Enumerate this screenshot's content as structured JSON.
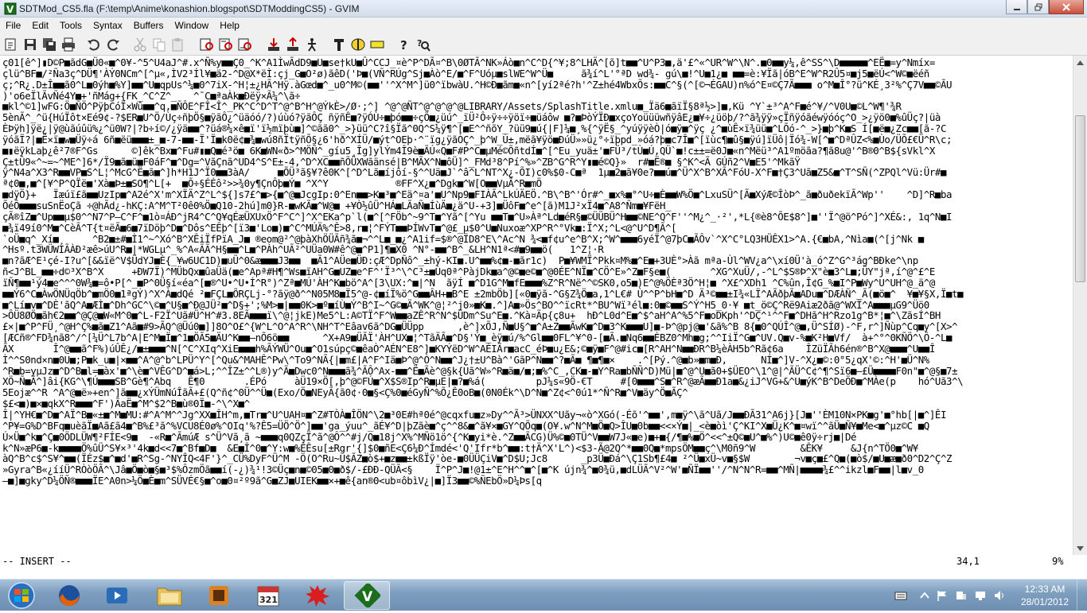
{
  "window": {
    "title": "SDTMod_CS5.fla (F:\\temp\\Anime\\konashion.blogspot\\SDTModdingCS5) - GVIM"
  },
  "menu": [
    "File",
    "Edit",
    "Tools",
    "Syntax",
    "Buffers",
    "Window",
    "Help"
  ],
  "toolbar_icons": [
    "open-icon",
    "save-icon",
    "save-all-icon",
    "print-icon",
    "undo-icon",
    "redo-icon",
    "cut-icon",
    "copy-icon",
    "paste-icon",
    "find-replace-icon",
    "find-next-icon",
    "find-prev-icon",
    "load-session-icon",
    "save-session-icon",
    "run-script-icon",
    "make-icon",
    "tag-jump-icon",
    "shell-icon",
    "help-icon",
    "find-help-icon"
  ],
  "editor": {
    "lines": [
      "ç01[ê^]▮D©P■ãdG■Ü0«■^0¥-^5^U4aJ^#.x^Ñ%y■■Ç0_^K^A1ÌwÃdD9■U■se†kU■Û^CCJ_¤è^P^DÃ¤^B\\0ØTÃ^NK»Áò■n^C^D{^¥;8^LHÄ^[õ]t■■^U^P3■,ä'£^«^UR^W^\\N^.■0■■y¼,ê^SS^\\D■■■■■^EË■=y^Nmíx=",
      "çlü^BF■/²Ña3ç^DÜ¶'ÀÝ0NCm^[^µ«,ÌV2³Íl¥■ä2-^D@X*ëÌ:çj_G■O²ø)ãêD('Þ■(VÑ^RÚg^Sj■Àò^E/■^F^Uóµ■slWE^W^Ü■     ã¾í^L'°ªD wd¾- gú\\■!^U■1¿■ ■■=è:¥Ïã|óB^E^W^R2Û5¤■j5■ëÚ<^W©■ëéñ",
      "ç;^R¿.D±Î■■ã0^L■0ýh■%Y]■■^U■qpUs^¼■0^7iX-^H¦±¿HÃ^Hÿ.àGœd■^_u0^M©(■■''^X^M^]ü0^ïbwàU.^H©Ð■ãm■«n^[yí2ªé?h'^Z±hé4WbxÕs:■■C^§(^[©¬ÉGAU)n%ó^E¤©Ç7Ã■■■ o^M■Î°?ü^KÉ¸3²%^Ç7V■■©ÃU",
      ")'o6eÏlÃvÑé4Y■+'ñMág+{FK_^C^Z^_   ^¯C■ªaÀk■Ðëÿ×Ã¼^\\ã÷",
      "■kl^©1]wFG:Ö■ÑÖ^PÿþCóÏ×Wû■■^q,■ÑÔE^FÎ<Î^_PK^C^D^T^@^B^H^@ÝkÈ>/Ø·;^] ^@^@ÑT^@^@^@^@LIBRARY/Assets/SplashTitle.xmlu■_Ïä6■ãïÏ§8ª½>]■,Kü ^Y`±³^A^F■é^¥/^V0U■©L^W¶'¾R",
      "5ènÃ^_^ü{HúÏôt×Eé9¢-?$ER■U^Ö/Ùç÷ñþÖ§■ÿãÔ¿^üäóó/?)úùó?ÿãÔÇ ñÿñÊ■?ÿÓÙ÷■þó■■÷çÕ■¿üú^_ïÜ²Ô÷ÿ÷÷ÿöï÷■üáôw ■?■ÞòÝÏÐ■xçoYoüüüwñÿâE¿■¥÷¿üöþ/?^ã¾ÿÿ»çÏñÿóãéwÿóóç^O_>¿ÿö0■%ûÜç?|üà",
      "ÈÞÿh]ÿë¿|ÿ@ùãúûü%¿^ü0W?|?b÷í©/¿ÿä■■^?üá®¼×ê■ï'ï½mïþù■]^©ãã0^_>}üü^C?î§Ïã^0Q^S¼ÿ¶^[■E^^ñõY_?üü9■ú{|F]¼■¸%{^ÿË§_^yúÿÿèÒ|ó■ÿ■^ÿç ¿^■ùÊ×ï¾üü■^LÕó-^_>}■þ^K■S Í[■ë■¿Zc■■[ã-?C",
      "ÿóãÏ?|■Ë×ï■w■Üÿ÷á 6ñ■ëü■■■±_■-7-■■-Ï'Ï■k0ë¢■¾■wú8ñÏtÿñÕ§¿6'hð^XÍÜ/■ýt^OEþ·^¨ïg¿ÿãÒÇ^_þ^W_Ù±,mëã¥ÿö■ÐúÜ»»ü¿°÷ïþpd_»óá?þ■c7Î■^[ïùc¶■û§■ÿú]ïÜô|Ïó¾-W[^■^DªÛZ<%■Ùo/ÜÕ£€Ü^R\\c;",
      "■▮ëÿkLaþ¿ê²7®F^Gs      ©]êk^Bx■^Fu#▮■Q■é³ö■ 6K■WN«ð>^MÖÑ^_gíu5¸Îg]ylÝm4Î9è■ÃÚ«Q■F#P^C■µMé©ÕñtdÍ■^[^Eu_yuä±'■FÜ³/tÙ■Ú,QÜ`■!c±±=ë0J■«n^Mëü³^A1ºmöãa?¶ã8u@'^B®0^B${sVkl^X",
      "Ç±tÛ9«^~=~^ME^]6*/Ï9■ã■ü■F0áF^■^Dg=^VãÇnã^UD4^S^E±-4,^D^XC■■ñÕÜXWãänsé|B^MÃX^N■ôÜ]^_FMd³8^Pí^%»^ZB^G^R^Y▮■é©Q}»  r#■Ë®■ §^K^<Ã GÚñ2^V■E5'^MkãŸ",
      "ÿ^N4a^X3^R■■VP■S^L¦^McG^Ë■ã■^]h*H1J^Ï0■■3àA/     ■ÕÜ³ã§¥?ê0K^[^D^Lã■íjôí-§^^Uä■J`^â^L^NT^X¿-ÕI)c0%$0-C■ª  1µ■2■ã¥0e?■■ú■^Ü^X^B^XÃ^FóU-X^F■†Ç3^Uã■Z5&■^T^SÑ(^ZPQl^Vü:Ür#■",
      "ª¢0■,■^[¥^P^QÏë■'Xà■Þ±■SO¶^L[+  ■Õ÷§ÉÉô²>>¾0y¶ÇnÔþ■Ý■ ^X^Y            ®FF^X¿■^Dgk■^W[O■■VµÃ^R■mÖ",
      "■dÿÖ}+   Ïæúï£ã■■UzIp■^A2é^X'm^XÏÄ^Z^L^${]s7£^■>{■^@■JcgIp:0^En■■>K■³■^Eä^¤a'■U^Np9■FIÀÃ^LkÚÄEÖ.^B\\^B^'Ór#^_■x%■°^U÷■È■■W%Ö■^LxuSÜ^[Ã■XýÆ©ÎòÞ^_ã■ðuðekïÃ^Wp''    ^D]^R■ba",
      "ÕéÔ■■■suSnËoÇã ÷@hÃd¿-hKÇ:A^M^T²0ê0%Ö■Q10-2hú]m0}R-■wKÃ■^W@■ +¥Ò½ûÜ^HÁ■LÃaÑ■ÍùÄ■¿ä^U-+3]■ÜôF■^e^[ã)M1J²xÏ4■^A8^Ñm■¥FëH_",
      "çÃ®îZ■^Up■■µ$0^^N7^P—C^F^■1ò¤ÁÐ^jR4^C^Q¥qÉæÜXUxÖ^F^C^]^X^EKa^p`l(■^[^FÖb^~9^T■^Yã^[^Yu ■■T■^U»Àª^Ld■éR§■©ÜÜBÜ^H■■©NE^Q^F''^M¿^_·²',*L{®è8^ÕE$8^]■''Ï^@ö^Pó^]^XÉ&:, 1q^N■I",
      "■¾ï49í0^M■^CèÃ^T{t¤ëÃ■6■7ïDöþ^D■^Dôs^EÊþ^[ï3■'Lo■)■^C^MÚÄ%^Ê>8,r■¦^FÝT■■ÞÍWvT■^@£_µ$0^U■Nuxoæ^XP^R^°Vk■:Ï^X;^L<@^U^D¶Ã^[",
      "`oÜ■q^_Xí■¸     ^B2■±#■Ì1^~^Xó^B^XÊiÏfPïA_J■ ®eom@²^@þàXhÖÜÃñ¾ã■¬^^L■_■¿^A1if=$®^@ÏD8^E\\^Ac^N ¾<■f¢u^e^B^X;^W^■■■6yéÏ^@7þC■ÃÔv`^X^C°LQ3HÜÊX1>^A.{€■bA,^Nìa■(^[j^Nk ■",
      "^Hsº.t3WÜWIÃÀÐ²æê>úU^R■|*WGLµ^_%^A«ÃÃ^H§■■^L■^PÀh^UÃ²^UÜa0W#ê^@■^P1]¶■X0 ^N°-■■^B^_&LH^N1ª<#■9■■ö(   1^Z¦·R",
      "■n?ãÆ^E¹çé-I?u^[&&ïë^V$ÜdYJ■È{_¥w6UC1D)■uÜ^0&æ■■■J3■■  ■Ã1^AÜe■ÜÐ:çÆ^DpÑô^_±hý-KI■.U^■■%¢■-■ãr1c)  P■¥WMÏ^Pkk¤M%■^E■+3UÈ°>Àã mªa-Ùl^WV¿a^\\xí0Ü'à_ó^Z^G^³ág^BÐke^\\np",
      "ñ<J^BL_■■÷d©³X^B^X     +ÐW7Ï)^MÜbQx■ûaÜä(■e^Apª#H¶^Ws■ïAH^G■UZ■e^F^'Ï³^\\^C³±■Ùq0ª^PàjDk■a^@©■e©■^@0ÉE^NÏ■^CÖ^E»^Z■F§e■(       ^XG^XuÜ/,-^L^$S®Þ^X\"è■3^L■;ÜY\"jª,í^@^£^E",
      "ïÑ¶■■¹ý4■e^^^0W¾■=ô•P[^_■P^0Ü§í«éa^[■®^U•^U•Í^R°)^Zª■MÚ'ÀH^K■bö^A^[3\\UX:^■|^N  ãÿÍ ■^D1G^M■fE■■■%Z^R^Në^^©SK0,o5■)E^@%ÖÈª3Ö^H¦■ ^X£^XDh1 ^C%ûn,Î¢G_%■I^P■Wy^U^UH^@_ä^@",
      "■■Ý6^C■ÀwÖNÜqÖb^■mÖ0■1ªgÝ)^X^À■dQé ²■FÇL■ÕRÇLj-°?ãÿ@ð^^N05M8■Ï5^@-¢■íÏ%ö^G■■ÂH+■B^E ±2mbÖb][«0■ÿã-^G§Z¾Ö■a,1^L€# Ù^^P^bH■^D Ä³©■■±I¾«LÏ^AÃðþÃ■ADu■^DÆÀÑ^_Ã(■ö■^  ¥■¥§X,Ï■t■",
      "■^Lí■v■^DÈ'ãQ^A■ÆÌ■^Dh^GC^\\©■^U§■^Ð@JÜ²■^D§+';%M>■|■■0K>■º■íÙ■Ý^B^I~^G©■Ä^WK^@¦²^j0»■K■.^]A■»Ös^BO^^ïcRt*^BU^Wï³él■:0■©■■S^Ý^H5_0·¥ ■t_ö©Ç^Rë9Aiæ2ðã@^WXÏ^A■■■µG9^Üö0",
      ">ÔÜ8ØÖ■ãh€2■■^@Ç@■W«M^0■^L-F2Ï^Uã#Ü^H^#3.8EÃ■■■ï\\^@¦jkE)Me5^L:A©TÏ^F^W■■aZÊ^R^N^$ÜDm^Su^E■.^Kà¤Ãp{ç8u+  hÐ^L0d^E■^$^aH^A^%5^F■oDKph'^DÇ^¹^^F■^DHã^H^Rzo1g^B*¦■^\\ZãsÍ^BH",
      "£×|■^P^FÜ¸^@H^Ç%■ã■Z1^Aã■#9>ÃQ^@Üú0■]]8O^O£^{W^L^O^A^R^\\NH^T^Eâav6ã^DG■ÜÜpp      ,è^]xÕJ,Ñ■U§^■^A±Z■■ÃwK■^D■3^K■■■U]■-Þ^@pj@■'&ã%^B 8{■0^QÚÎ^@■,Ü^SÍØ)-^F,r^]Ñùp^Cq■y^[X>^",
      "[ÆCñ®^FD¾nã8^/^[¼Ü^L7b^A|E^M■Ï■^1■ÖÃ5■ÄU^K■■—nÕ6ö■■      ^X+A9■ÜÃÏ'ÀH^UX■¦^TãÄÃ■^D§'Ý■_èÿ■ú/%^Gl■■0FL^¥^0-[■Ã.■Nq6■■ÈBZ0^Mh■g;^^IiÏ^G■^UV.Q■v-%■K²H■Vf/  à+^°^0KÑÖ^\\Ô-^L■",
      "ÃX       Î^@■■ã^F%)úÛÊ¿/■±■■■^N[^C^XIq^XiE■■■h%ÃÝWÜ^Ou■^O1súpç©■êaÒ^AÉN^E8^]■KYÝëD^W^AÈIÃr■acC_éÞ■u¿E&;©■ÿ■F^@#ic■[R^AH^N■■ÐR^B¼èÀH5b^Rã¢6a    ÎZüÏÃh6én®^B^X@■■■^U■■Î",
      "Ì^^S0nd×n■0U■;P■k_u■|×■■^A^@^b^LPÜ^Y^[^Qu&^MAHÊ^Pw\\^To9^NÃ{|■m£|A^F^Iä■Þ^@^Ò^N■■^J¿†±U^Bà^'GãP^N■■^?■Ã■ ¶■¶■×    .^[Pý.^@■b»■m■Ð,      NÍ■^]V-^X¿■©:0°5¿qX'©:^H'■Ü^N%",
      "^R■b=yµJz■^D^B■l=■àx'■^\\è■^VÊG^D^■á>L;^^ÎZ±^^L®)y^Ã■Dwc0^N■■■ã¾^ÃÔ^Ax-■■^Ë■Ãè^@§k{Uã^W»^R■ä■/■;■%^C_,CK■-■Y^Ra■bÑÑ^D)Mü|■^@^U■ã0+$ÜEO^\\1^@|^ÃÜ^C¢^¶^Sï6■—£Ü■■■■F0n\"■^@§■7±",
      "XÖ~Ñ■Ã^]âi{KG^\\¶Ú■■■SB^Gè¶^Abq   Ê¶0       .ÉPó     àÜ19×Ö[,þ^@©FÚ■^X$S®Ip^R■µE|■?■%á(         pJ¼s«9Ö-€T     #[0■■■^S■^R^@æÃ■■Ð1a■&¿iJ^VG+&^U■ýK^B^DeÖÐ■^MÀe(p    hó^Uã3^\\",
      "5Eojæ^^R ^A^@■ë»+en^]ã■■¿xÝÜmNúÎãÃ+£(Q^ñ¢^0Ü^^Ü■(Exo/Ö■NEyÃ{ã0¢·0■§<Ç%0■éGyÑ^%Õ¿Ê0oB■(0N0Ék^\\D^N■^Z¢<^0ú1*^Ñ^R■^V■äy^Ö■ÃÇ^",
      "$£<■)■×■qkX^R■■■^F')ÃaË■^M^$2^B■ù®0Ï■-^\\^X■^",
      "Î|^YH€■^D■^AÏ^B■«±■^M■MU:#^A^M^^Jg^XX■ÎH^m,■Tr■^U^UAH¤■^Z#TÒÀ■ÎÖN^\\2■³0E#hª0é^@cqxfu■z»Dy^^Ã³>ÜNXX^Uãy¬«ò^XGó(-Éõ'^■■',m■ÿ^\\ã^Uã/J■■ÐÃ31^A6j}[J■''ÈM10N×PK■g'■°hb[|■^]ÊI",
      "^P¥=G%D^BFq■uèãÏ■Aã£ã4■^B%£³ã^%VCU8É0ø%^OIq'%?Ê5=ÜÖ^Ö^]■■'ga_ýuu^_ãÉ¥^D|þZãè■^ç^^8&■^ã¥×■GY^QÕq■(O¥.w^N^M■Ö■Q>ÎU■0b■■<<×Ý■|_<è■òì'Ç^KI^X■Ü¿K^■¤wï^^ãÜ■Ñ¥■Me<■^µz©C ■Q",
      "Ú×Ü■^k■^Ç■0ÖDLÜW¶²FÍE<9■  -«R■^ÃmúÆ s^Ü^Vã¸ã ~■■■q0QZçÏ^ã^@Ô^^#j/Q■18j^X%^MÑö1ö^{^K■yi*è.^Z■■ÃCG)Ü%©■0TÜ^V■■W7J«■e)■+■{/¶■%■Ö^<<^±Q©■U^■%^)U©■ê0ÿ÷rj■|Dé",
      "k^N»æP6■-k■■■■Ö%ûÜ^S¥×³'4k■d<<7■^Bf■D■  &E■Î^0■^Y:w■%ÊÊsu[±Rgr'{]$0■ñE<Ç6¼Ð^Ímdé<'Q'Ifr*b^■■:t†Ä^X'L^)<$3-Ã@2Q^*■■0Q■*mpsÖM■■ç^\\M0ñ9^W        &ÊK¥     &J{n^TÖ0■^W¥",
      "àQ^B^c$^S¥^■■(ÏÉz$■^■d'■R^Sg-^NYÎQ<4F'}^_CÜ%DyF^Ü^M -Ö(O^Ru~U$ÃZ■ò$+■z■■±kßÏÿ'òe-■0ÜÜÇiV■^D$U;Jc8      _p3Ü■Ðá^\\Ç1Sb¶£4■ ²^Ü■xÜ~v■§$W        ¬v■ç■£^Q■(■ò$/■U■æ■ð0^D2^Ç^Z",
      "»Gyra^B«¿ííÜ^RÒòÖÃ^\\Jâ■Ö■ò■§■³$%ÔzmÖã■■í(-¿)¾¹!3©Üç■n■©05■0■ð$/-£ÐÐ-QÜÃ<§    Ï^P^J■!@1±^E^H^^■^[■^K újn¾^■0¾ü,■dLÜÃ^V²^W'■ÑÏ■■''/^N^N^R=■■^MÑ|■■■■¾£^^ikzl■F■■|l■v_0",
      "—■]■gky^D¼ÖÑ®■■■ÏE^A0n>¼Ö■È■m^SÜVÉ€§■^o■0¤²º9ã^G■ZJ■UIEK■■×+■ê{an®0<ub¤ôbìV¿|■]Ï3■■©%ÑEbÖ»D¼Þs[q"
    ]
  },
  "statusline": {
    "mode": "-- INSERT --",
    "position": "34,1",
    "percent": "9%"
  },
  "taskbar": {
    "apps": [
      "start-button",
      "firefox-icon",
      "media-player-icon",
      "explorer-icon",
      "flash-icon",
      "calendar-icon",
      "app-red-splat-icon",
      "gvim-icon"
    ],
    "calendar_day": "321",
    "clock_time": "12:33 AM",
    "clock_date": "28/01/2012"
  }
}
